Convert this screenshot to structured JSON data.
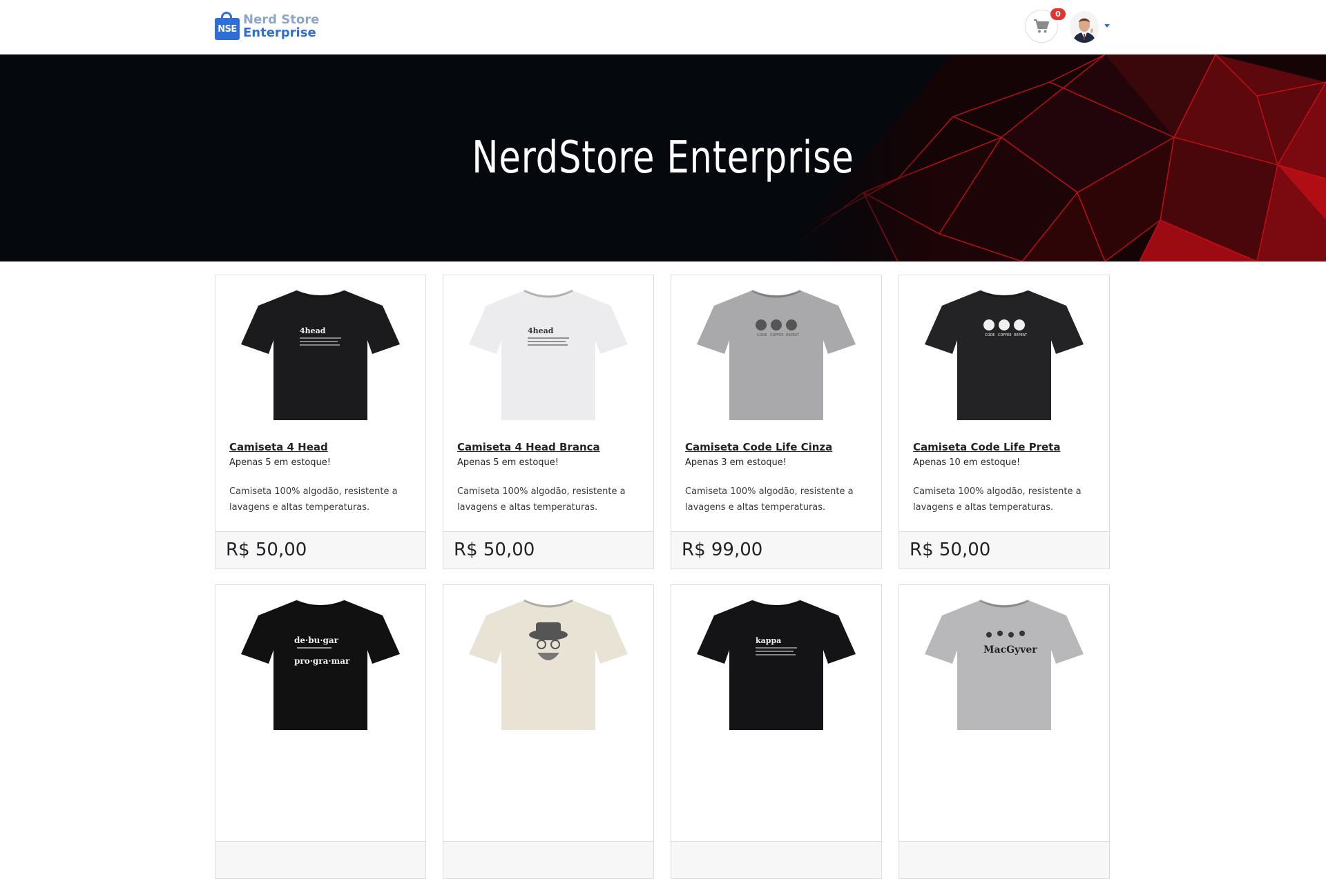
{
  "brand": {
    "logo_text": "NSE",
    "line1": "Nerd Store",
    "line2": "Enterprise"
  },
  "header": {
    "cart_count": "0"
  },
  "hero": {
    "title": "NerdStore Enterprise"
  },
  "colors": {
    "brand_blue": "#2e6fd6",
    "badge_red": "#e3342f",
    "hero_bg": "#05080d",
    "hero_accent": "#d10f14"
  },
  "products": [
    {
      "name": "Camiseta 4 Head",
      "stock": "Apenas 5 em estoque!",
      "description": "Camiseta 100% algodão, resistente a lavagens e altas temperaturas.",
      "price": "R$ 50,00",
      "shirt_color": "#1b1a1d",
      "print_text": "4head"
    },
    {
      "name": "Camiseta 4 Head Branca",
      "stock": "Apenas 5 em estoque!",
      "description": "Camiseta 100% algodão, resistente a lavagens e altas temperaturas.",
      "price": "R$ 50,00",
      "shirt_color": "#ececee",
      "print_text": "4head"
    },
    {
      "name": "Camiseta Code Life Cinza",
      "stock": "Apenas 3 em estoque!",
      "description": "Camiseta 100% algodão, resistente a lavagens e altas temperaturas.",
      "price": "R$ 99,00",
      "shirt_color": "#a9a9ab",
      "print_text": ""
    },
    {
      "name": "Camiseta Code Life Preta",
      "stock": "Apenas 10 em estoque!",
      "description": "Camiseta 100% algodão, resistente a lavagens e altas temperaturas.",
      "price": "R$ 50,00",
      "shirt_color": "#232325",
      "print_text": ""
    },
    {
      "name": "",
      "stock": "",
      "description": "",
      "price": "",
      "shirt_color": "#111111",
      "print_text": "de·bu·gar"
    },
    {
      "name": "",
      "stock": "",
      "description": "",
      "price": "",
      "shirt_color": "#e9e3d6",
      "print_text": ""
    },
    {
      "name": "",
      "stock": "",
      "description": "",
      "price": "",
      "shirt_color": "#141416",
      "print_text": "kappa"
    },
    {
      "name": "",
      "stock": "",
      "description": "",
      "price": "",
      "shirt_color": "#b8b8ba",
      "print_text": "MacGyver"
    }
  ]
}
